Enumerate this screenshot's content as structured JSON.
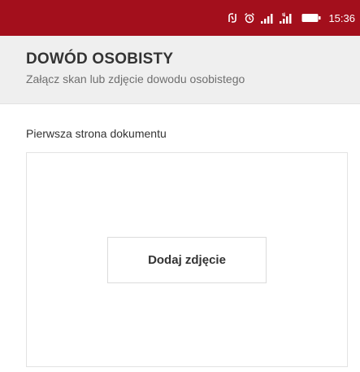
{
  "status_bar": {
    "time": "15:36",
    "background_color": "#a30f1c",
    "icons": [
      "nfc-icon",
      "alarm-icon",
      "signal-icon",
      "signal-4g-icon",
      "battery-icon"
    ]
  },
  "header": {
    "title": "DOWÓD OSOBISTY",
    "subtitle": "Załącz skan lub zdjęcie dowodu osobistego"
  },
  "document_section": {
    "label": "Pierwsza strona dokumentu",
    "add_photo_label": "Dodaj zdjęcie"
  }
}
